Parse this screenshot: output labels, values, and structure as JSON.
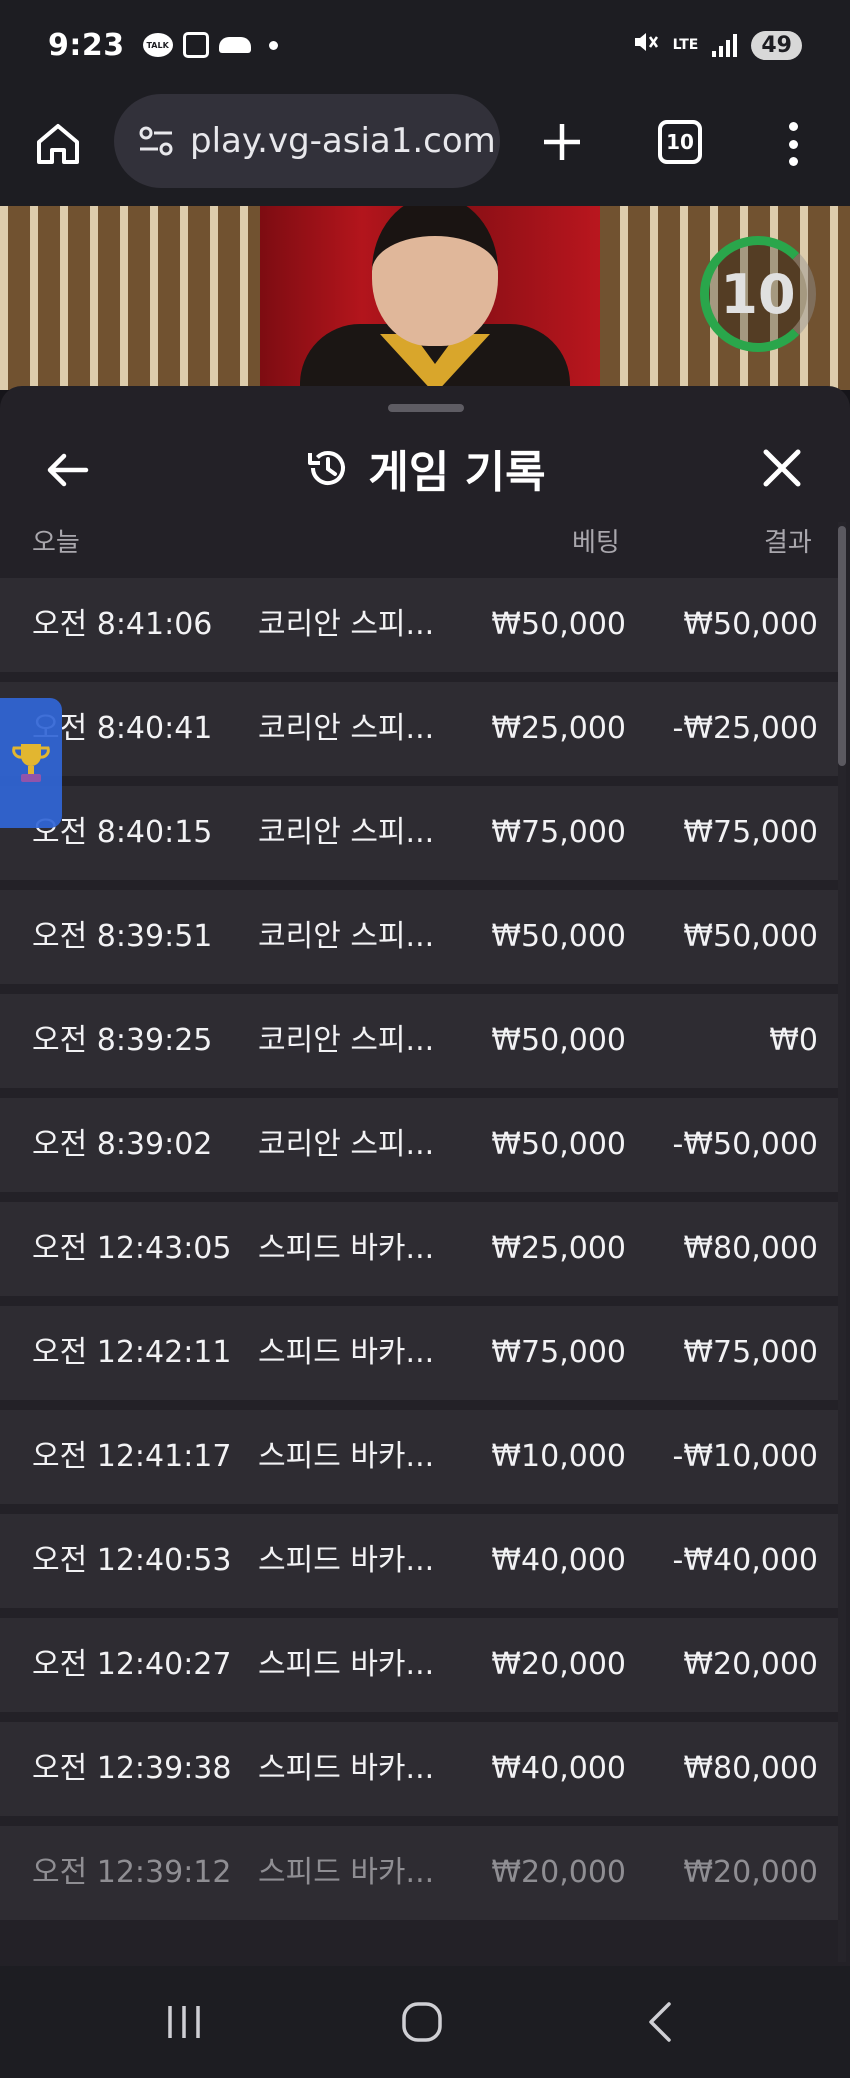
{
  "status_bar": {
    "time": "9:23",
    "talk_label": "TALK",
    "network": "LTE",
    "battery": "49"
  },
  "browser": {
    "url": "play.vg-asia1.com",
    "tab_count": "10"
  },
  "video": {
    "countdown": "10"
  },
  "panel": {
    "title": "게임 기록",
    "columns": {
      "date": "오늘",
      "bet": "베팅",
      "result": "결과"
    },
    "rows": [
      {
        "time": "오전 8:41:06",
        "game": "코리안 스피...",
        "bet": "₩50,000",
        "result": "₩50,000"
      },
      {
        "time": "오전 8:40:41",
        "game": "코리안 스피...",
        "bet": "₩25,000",
        "result": "-₩25,000"
      },
      {
        "time": "오전 8:40:15",
        "game": "코리안 스피...",
        "bet": "₩75,000",
        "result": "₩75,000"
      },
      {
        "time": "오전 8:39:51",
        "game": "코리안 스피...",
        "bet": "₩50,000",
        "result": "₩50,000"
      },
      {
        "time": "오전 8:39:25",
        "game": "코리안 스피...",
        "bet": "₩50,000",
        "result": "₩0"
      },
      {
        "time": "오전 8:39:02",
        "game": "코리안 스피...",
        "bet": "₩50,000",
        "result": "-₩50,000"
      },
      {
        "time": "오전 12:43:05",
        "game": "스피드 바카...",
        "bet": "₩25,000",
        "result": "₩80,000"
      },
      {
        "time": "오전 12:42:11",
        "game": "스피드 바카...",
        "bet": "₩75,000",
        "result": "₩75,000"
      },
      {
        "time": "오전 12:41:17",
        "game": "스피드 바카...",
        "bet": "₩10,000",
        "result": "-₩10,000"
      },
      {
        "time": "오전 12:40:53",
        "game": "스피드 바카...",
        "bet": "₩40,000",
        "result": "-₩40,000"
      },
      {
        "time": "오전 12:40:27",
        "game": "스피드 바카...",
        "bet": "₩20,000",
        "result": "₩20,000"
      },
      {
        "time": "오전 12:39:38",
        "game": "스피드 바카...",
        "bet": "₩40,000",
        "result": "₩80,000"
      },
      {
        "time": "오전 12:39:12",
        "game": "스피드 바카...",
        "bet": "₩20,000",
        "result": "₩20,000"
      }
    ]
  },
  "icons": {
    "home": "home-icon",
    "site_settings": "tune-icon",
    "new_tab": "plus-icon",
    "tabs": "tabs-icon",
    "menu": "more-vert-icon",
    "back": "arrow-left-icon",
    "history": "history-icon",
    "close": "close-icon",
    "trophy": "trophy-icon",
    "recents": "recents-icon",
    "home_nav": "home-circle-icon",
    "back_nav": "chevron-left-icon"
  },
  "colors": {
    "panel_bg": "#232127",
    "row_bg": "#2e2c32",
    "timer_green": "#2aa64b",
    "trophy_tab": "#3166d6"
  }
}
